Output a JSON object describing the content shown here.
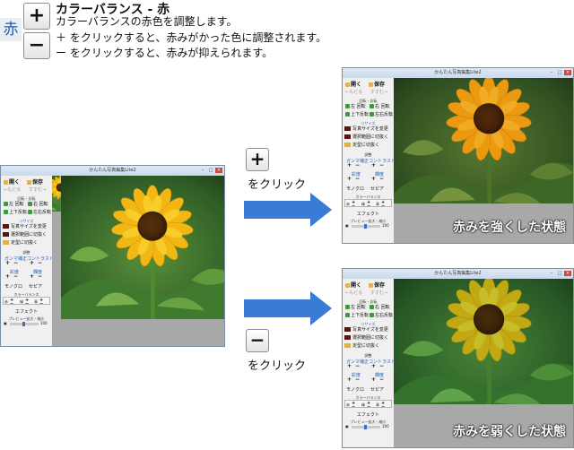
{
  "header": {
    "side_label": "赤",
    "plus_glyph": "+",
    "minus_glyph": "−",
    "title": "カラーバランス - 赤",
    "lines": [
      "カラーバランスの赤色を調整します。",
      "＋ をクリックすると、赤みがかった色に調整されます。",
      "ー をクリックすると、赤みが抑えられます。"
    ]
  },
  "app": {
    "window_title": "かんたん写真編集Lite2",
    "open_label": "開く",
    "save_label": "保存",
    "undo_label": "←もどる",
    "redo_label": "すすむ→",
    "rotate_flip_section": "回転・反転",
    "rotate_left_label": "左 回転",
    "rotate_right_label": "右 回転",
    "flip_v_label": "上下反転",
    "flip_h_label": "左右反転",
    "resize_section": "リサイズ",
    "resize_label": "写真サイズを変更",
    "crop_label": "選択範囲に切抜く",
    "fixed_crop_label": "定型に切抜く",
    "adjust_section": "調整",
    "gamma_label": "ガンマ補正",
    "contrast_label": "コントラスト",
    "saturation_label": "彩度",
    "brightness_label": "輝度",
    "mono_label": "モノクロ",
    "sepia_label": "セピア",
    "color_balance_section": "カラーバランス",
    "red_label": "赤",
    "green_label": "緑",
    "blue_label": "青",
    "effect_label": "エフェクト",
    "preview_label": "プレビュー拡大・縮小",
    "zoom_value": "100"
  },
  "steps": {
    "plus_glyph": "+",
    "minus_glyph": "−",
    "click_text": "をクリック",
    "stronger_caption": "赤みを強くした状態",
    "weaker_caption": "赤みを弱くした状態"
  },
  "colors": {
    "arrow": "#3a7bd5",
    "accent_blue": "#1f5fbf",
    "stronger_tint": "#e0402a",
    "weaker_tint": "#1aa8c8"
  }
}
